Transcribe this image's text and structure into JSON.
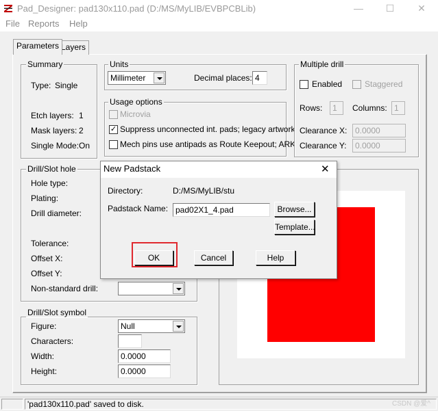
{
  "window": {
    "title": "Pad_Designer: pad130x110.pad  (D:/MS/MyLIB/EVBPCBLib)",
    "minimize": "—",
    "maximize": "☐",
    "close": "✕"
  },
  "menu": [
    "File",
    "Reports",
    "Help"
  ],
  "tabs": [
    "Parameters",
    "Layers"
  ],
  "summary": {
    "legend": "Summary",
    "type_label": "Type:",
    "type_value": "Single",
    "etch_label": "Etch layers:",
    "etch_value": "1",
    "mask_label": "Mask layers:",
    "mask_value": "2",
    "mode_label": "Single Mode:",
    "mode_value": "On"
  },
  "units": {
    "legend": "Units",
    "selected": "Millimeter",
    "decimal_label": "Decimal places:",
    "decimal_value": "4"
  },
  "usage": {
    "legend": "Usage options",
    "microvia": "Microvia",
    "suppress": "Suppress unconnected int. pads; legacy artwork",
    "mechpins": "Mech pins use antipads as Route Keepout; ARK"
  },
  "multiple_drill": {
    "legend": "Multiple drill",
    "enabled": "Enabled",
    "staggered": "Staggered",
    "rows_label": "Rows:",
    "rows_value": "1",
    "columns_label": "Columns:",
    "columns_value": "1",
    "clearance_x_label": "Clearance X:",
    "clearance_x_value": "0.0000",
    "clearance_y_label": "Clearance Y:",
    "clearance_y_value": "0.0000"
  },
  "drill": {
    "legend": "Drill/Slot hole",
    "hole_type": "Hole type:",
    "plating": "Plating:",
    "diameter": "Drill diameter:",
    "tolerance": "Tolerance:",
    "offset_x": "Offset X:",
    "offset_y": "Offset Y:",
    "nonstandard": "Non-standard drill:"
  },
  "drill_symbol": {
    "legend": "Drill/Slot symbol",
    "figure_label": "Figure:",
    "figure_value": "Null",
    "characters_label": "Characters:",
    "width_label": "Width:",
    "width_value": "0.0000",
    "height_label": "Height:",
    "height_value": "0.0000"
  },
  "dialog": {
    "title": "New Padstack",
    "close": "✕",
    "directory_label": "Directory:",
    "directory_value": "D:/MS/MyLIB/stu",
    "name_label": "Padstack Name:",
    "name_value": "pad02X1_4.pad",
    "browse": "Browse...",
    "template": "Template...",
    "ok": "OK",
    "cancel": "Cancel",
    "help": "Help"
  },
  "status": {
    "message": "'pad130x110.pad' saved to disk.",
    "watermark": "CSDN @爱^"
  },
  "colors": {
    "preview_pad": "#ff0000",
    "highlight": "#e0282e"
  }
}
